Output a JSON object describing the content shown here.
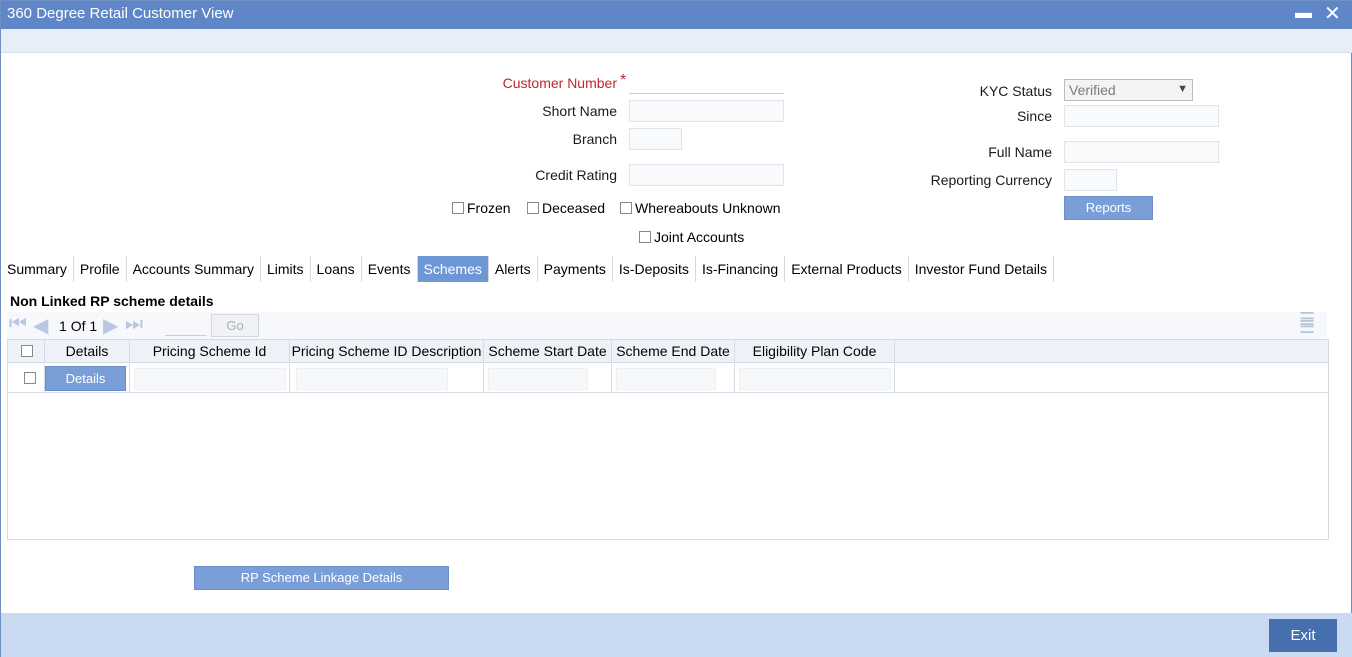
{
  "window": {
    "title": "360 Degree Retail Customer View",
    "minimize_glyph": "▬",
    "close_glyph": "✕"
  },
  "form": {
    "customer_number_label": "Customer Number",
    "required_mark": "*",
    "short_name_label": "Short Name",
    "branch_label": "Branch",
    "credit_rating_label": "Credit Rating",
    "kyc_status_label": "KYC Status",
    "kyc_status_value": "Verified",
    "since_label": "Since",
    "full_name_label": "Full Name",
    "reporting_currency_label": "Reporting Currency",
    "reports_button": "Reports",
    "frozen_label": "Frozen",
    "deceased_label": "Deceased",
    "whereabouts_label": "Whereabouts Unknown",
    "joint_accounts_label": "Joint Accounts"
  },
  "tabs": [
    "Summary",
    "Profile",
    "Accounts Summary",
    "Limits",
    "Loans",
    "Events",
    "Schemes",
    "Alerts",
    "Payments",
    "Is-Deposits",
    "Is-Financing",
    "External Products",
    "Investor Fund Details"
  ],
  "active_tab": "Schemes",
  "section": {
    "title": "Non Linked RP scheme details",
    "pager": {
      "current": "1",
      "of_label": "Of",
      "total": "1",
      "go_label": "Go"
    },
    "columns": [
      "Details",
      "Pricing Scheme Id",
      "Pricing Scheme ID Description",
      "Scheme Start Date",
      "Scheme End Date",
      "Eligibility Plan Code"
    ],
    "row_details_button": "Details"
  },
  "linkage_button": "RP Scheme Linkage Details",
  "exit_button": "Exit",
  "colors": {
    "titlebar": "#5f86c6",
    "active_tab": "#6e97d6",
    "footer": "#c9daf1",
    "exit": "#456fae",
    "required": "#c0262b"
  }
}
